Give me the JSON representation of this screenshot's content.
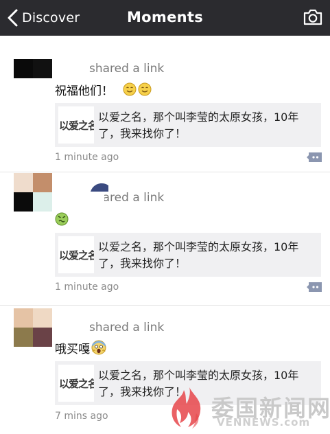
{
  "nav": {
    "back_label": "Discover",
    "title": "Moments"
  },
  "posts": [
    {
      "sharer_text": "shared a link",
      "text": "祝福他们！",
      "link_thumb_text": "以爱之名",
      "link_title": "以爱之名，那个叫李莹的太原女孩，10年了，我来找你了！",
      "time": "1 minute ago"
    },
    {
      "sharer_text": "shared a link",
      "text": "",
      "link_thumb_text": "以爱之名",
      "link_title": "以爱之名，那个叫李莹的太原女孩，10年了，我来找你了！",
      "time": "1 minute ago"
    },
    {
      "sharer_text": "shared a link",
      "text": "哦买嘎",
      "link_thumb_text": "以爱之名",
      "link_title": "以爱之名，那个叫李莹的太原女孩，10年了，我来找你了！",
      "time": "7 mins ago"
    }
  ],
  "watermark": {
    "name": "委国新闻网",
    "domain": "VENNEWS.com"
  },
  "icons": {
    "back": "chevron-left-icon",
    "camera": "camera-icon",
    "comment": "comment-icon",
    "emoji_smile": "smiling-face-icon",
    "emoji_sick": "nauseated-face-icon",
    "emoji_scream": "screaming-face-icon"
  },
  "colors": {
    "navbar": "#2b2b2f",
    "card": "#f0f0f2",
    "comment_button": "#8b96b0",
    "watermark": "#c9c9c9"
  }
}
